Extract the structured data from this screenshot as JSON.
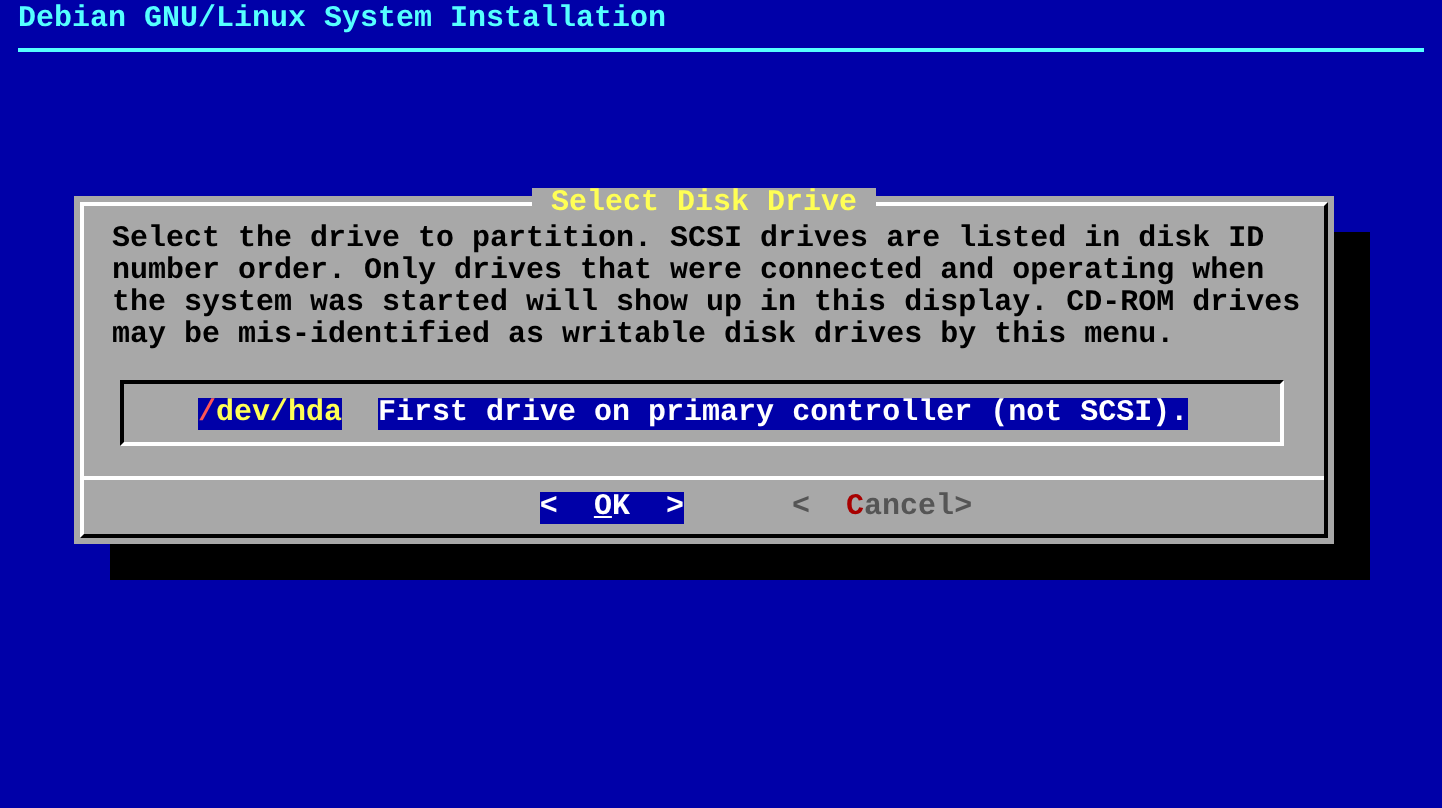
{
  "screen_title": "Debian GNU/Linux System Installation",
  "dialog": {
    "title": "Select Disk Drive",
    "message": "Select the drive to partition. SCSI drives are listed in disk ID number order. Only drives that were connected and operating when the system was started will show up in this display. CD-ROM drives may be mis-identified as writable disk drives by this menu.",
    "drives": [
      {
        "hotkey": "/",
        "rest": "dev/hda",
        "description": "First drive on primary controller (not SCSI).",
        "selected": true
      }
    ],
    "buttons": [
      {
        "open": "<",
        "hotkey": "O",
        "rest": "K",
        "close": ">",
        "selected": true
      },
      {
        "open": "<",
        "hotkey": "C",
        "rest": "ancel",
        "close": ">",
        "selected": false
      }
    ]
  }
}
